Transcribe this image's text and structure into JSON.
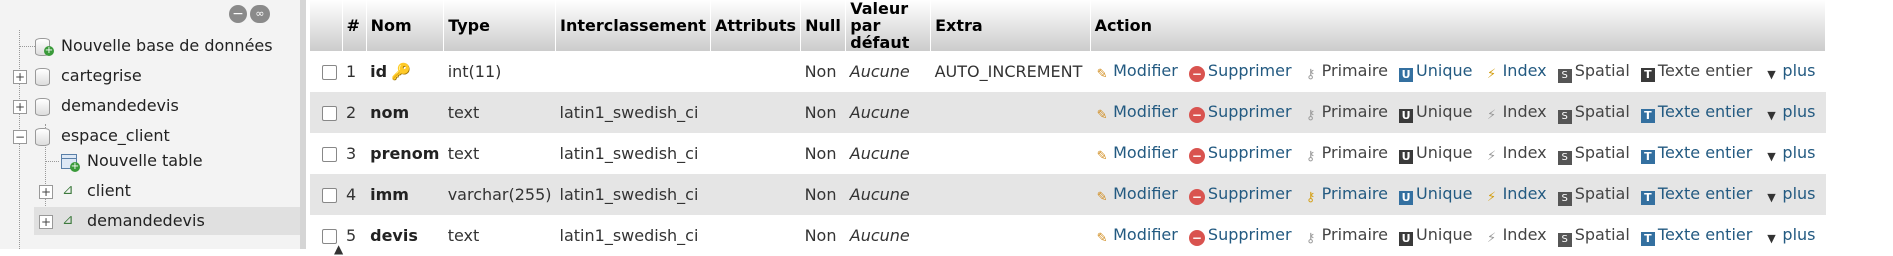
{
  "nav": {
    "items": [
      {
        "label": "Nouvelle base de données"
      },
      {
        "label": "cartegrise"
      },
      {
        "label": "demandedevis"
      },
      {
        "label": "espace_client"
      },
      {
        "label": "Nouvelle table"
      },
      {
        "label": "client"
      },
      {
        "label": "demandedevis"
      }
    ]
  },
  "table": {
    "headers": [
      "#",
      "Nom",
      "Type",
      "Interclassement",
      "Attributs",
      "Null",
      "Valeur par défaut",
      "Extra",
      "Action"
    ],
    "rows": [
      {
        "num": "1",
        "name": "id",
        "type": "int(11)",
        "collation": "",
        "attributes": "",
        "null": "Non",
        "default": "Aucune",
        "extra": "AUTO_INCREMENT"
      },
      {
        "num": "2",
        "name": "nom",
        "type": "text",
        "collation": "latin1_swedish_ci",
        "attributes": "",
        "null": "Non",
        "default": "Aucune",
        "extra": ""
      },
      {
        "num": "3",
        "name": "prenom",
        "type": "text",
        "collation": "latin1_swedish_ci",
        "attributes": "",
        "null": "Non",
        "default": "Aucune",
        "extra": ""
      },
      {
        "num": "4",
        "name": "imm",
        "type": "varchar(255)",
        "collation": "latin1_swedish_ci",
        "attributes": "",
        "null": "Non",
        "default": "Aucune",
        "extra": ""
      },
      {
        "num": "5",
        "name": "devis",
        "type": "text",
        "collation": "latin1_swedish_ci",
        "attributes": "",
        "null": "Non",
        "default": "Aucune",
        "extra": ""
      }
    ],
    "actions": {
      "modify": "Modifier",
      "delete": "Supprimer",
      "primary": "Primaire",
      "unique": "Unique",
      "index": "Index",
      "spatial": "Spatial",
      "fulltext": "Texte entier",
      "more": "plus"
    }
  },
  "colors": {
    "link": "#235a81",
    "row_alt": "#e5e5e5",
    "nav_bg": "#f3f3f3"
  }
}
